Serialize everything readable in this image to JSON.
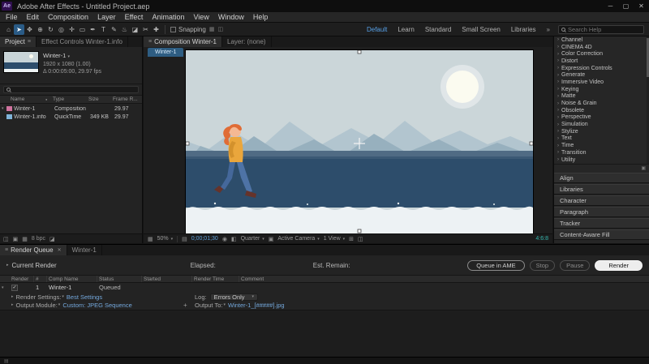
{
  "icons": {
    "menu": "≡",
    "chevron_right": "›",
    "caret_down": "▾",
    "caret_right": "▸",
    "close": "✕",
    "minimize": "─",
    "maximize": "▢",
    "overflow": "»",
    "plus": "+",
    "check": "✓",
    "dot": "●",
    "grid": "▦",
    "ruler": "▤",
    "snapshot": "◉",
    "channels": "◧",
    "region": "▣",
    "pixel_aspect": "◫",
    "mixed": "◪",
    "cube": "⊞"
  },
  "titlebar": {
    "app_badge": "Ae",
    "title": "Adobe After Effects - Untitled Project.aep"
  },
  "menubar": {
    "items": [
      "File",
      "Edit",
      "Composition",
      "Layer",
      "Effect",
      "Animation",
      "View",
      "Window",
      "Help"
    ]
  },
  "toolbar": {
    "tools": [
      {
        "name": "home",
        "glyph": "⌂"
      },
      {
        "name": "selection",
        "glyph": "➤"
      },
      {
        "name": "hand",
        "glyph": "✥"
      },
      {
        "name": "zoom",
        "glyph": "⊕"
      },
      {
        "name": "orbit",
        "glyph": "↻"
      },
      {
        "name": "camera",
        "glyph": "◎"
      },
      {
        "name": "pan-behind",
        "glyph": "✛"
      },
      {
        "name": "shape",
        "glyph": "▭"
      },
      {
        "name": "pen",
        "glyph": "✒"
      },
      {
        "name": "type",
        "glyph": "T"
      },
      {
        "name": "brush",
        "glyph": "✎"
      },
      {
        "name": "clone-stamp",
        "glyph": "♨"
      },
      {
        "name": "eraser",
        "glyph": "◪"
      },
      {
        "name": "roto-brush",
        "glyph": "✂"
      },
      {
        "name": "puppet-pin",
        "glyph": "✚"
      }
    ],
    "snapping_label": "Snapping",
    "workspaces": [
      "Default",
      "Learn",
      "Standard",
      "Small Screen",
      "Libraries"
    ],
    "search_placeholder": "Search Help"
  },
  "project_panel": {
    "tab_project": "Project",
    "tab_effect_controls": "Effect Controls Winter-1.info",
    "info_name": "Winter-1",
    "info_dimensions": "1920 x 1080 (1.00)",
    "info_duration": "Δ 0:00:05:00, 29.97 fps",
    "columns": {
      "name": "Name",
      "type": "Type",
      "size": "Size",
      "rate": "Frame R..."
    },
    "rows": [
      {
        "name": "Winter-1",
        "type": "Composition",
        "size": "",
        "rate": "29.97"
      },
      {
        "name": "Winter-1.info",
        "type": "QuickTime",
        "size": "349 KB",
        "rate": "29.97"
      }
    ],
    "bit_depth": "8 bpc"
  },
  "composition_panel": {
    "tab_composition": "Composition Winter-1",
    "tab_layer": "Layer:  (none)",
    "viewer_tab": "Winter-1",
    "zoom": "50%",
    "timecode": "0;00;01;30",
    "resolution": "Quarter",
    "camera": "Active Camera",
    "view_count": "1 View",
    "readout": "4:6:8"
  },
  "effects_panel": {
    "categories": [
      "Channel",
      "CINEMA 4D",
      "Color Correction",
      "Distort",
      "Expression Controls",
      "Generate",
      "Immersive Video",
      "Keying",
      "Matte",
      "Noise & Grain",
      "Obsolete",
      "Perspective",
      "Simulation",
      "Stylize",
      "Text",
      "Time",
      "Transition",
      "Utility"
    ]
  },
  "side_panels": [
    "Align",
    "Libraries",
    "Character",
    "Paragraph",
    "Tracker",
    "Content-Aware Fill"
  ],
  "render_queue": {
    "tab_render_queue": "Render Queue",
    "tab_comp": "Winter-1",
    "current_render_label": "Current Render",
    "elapsed_label": "Elapsed:",
    "est_remain_label": "Est. Remain:",
    "queue_in_ame": "Queue in AME",
    "stop": "Stop",
    "pause": "Pause",
    "render": "Render",
    "columns": {
      "render": "Render",
      "num": "#",
      "comp_name": "Comp Name",
      "status": "Status",
      "started": "Started",
      "render_time": "Render Time",
      "comment": "Comment"
    },
    "row": {
      "num": "1",
      "comp_name": "Winter-1",
      "status": "Queued"
    },
    "render_settings_label": "Render Settings:",
    "render_settings_value": "Best Settings",
    "log_label": "Log:",
    "log_value": "Errors Only",
    "output_module_label": "Output Module:",
    "output_module_value": "Custom: JPEG Sequence",
    "output_to_label": "Output To:",
    "output_to_value": "Winter-1_[#####].jpg"
  }
}
